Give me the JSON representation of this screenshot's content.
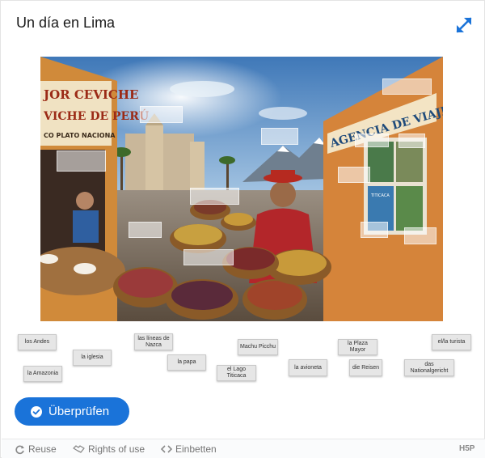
{
  "header": {
    "title": "Un día en Lima"
  },
  "fullscreen": {
    "icon": "expand-icon"
  },
  "scene": {
    "sign_left_line1": "JOR CEVICHE",
    "sign_left_line2": "VICHE DE PERÚ",
    "sign_left_line3": "CO PLATO NACIONA",
    "sign_right": "AGENCIA DE VIAJES",
    "poster_label": "TITICACA"
  },
  "draggables": [
    {
      "id": "los-andes",
      "label": "los Andes"
    },
    {
      "id": "la-iglesia",
      "label": "la iglesia"
    },
    {
      "id": "la-amazonia",
      "label": "la Amazonia"
    },
    {
      "id": "las-lineas",
      "label": "las líneas de Nazca"
    },
    {
      "id": "la-papa",
      "label": "la papa"
    },
    {
      "id": "machu-picchu",
      "label": "Machu Picchu"
    },
    {
      "id": "lago-titicaca",
      "label": "el Lago Titicaca"
    },
    {
      "id": "la-plaza-mayor",
      "label": "la Plaza Mayor"
    },
    {
      "id": "la-avioneta",
      "label": "la avioneta"
    },
    {
      "id": "die-reisen",
      "label": "die Reisen"
    },
    {
      "id": "el-turista",
      "label": "el/la turista"
    },
    {
      "id": "das-nationalgericht",
      "label": "das Nationalgericht"
    }
  ],
  "actions": {
    "check_label": "Überprüfen"
  },
  "footer": {
    "reuse": "Reuse",
    "rights": "Rights of use",
    "embed": "Einbetten",
    "logo": "H5P"
  },
  "colors": {
    "accent": "#1a73d9",
    "chip_bg": "#e6e6e6"
  }
}
